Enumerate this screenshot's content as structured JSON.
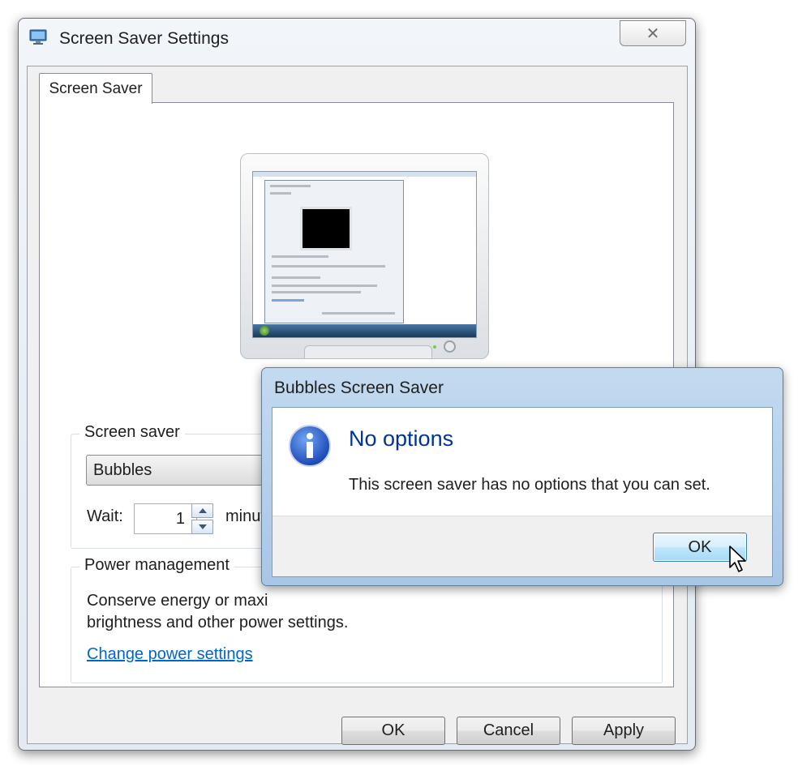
{
  "main_window": {
    "title": "Screen Saver Settings",
    "close_glyph": "✕",
    "tab_label": "Screen Saver",
    "screen_saver_group": {
      "legend": "Screen saver",
      "selected_saver": "Bubbles",
      "wait_label": "Wait:",
      "wait_value": "1",
      "wait_unit": "minut"
    },
    "power_group": {
      "legend": "Power management",
      "description": "Conserve energy or maxi",
      "description_line2": "brightness and other power settings.",
      "link_label": "Change power settings"
    },
    "buttons": {
      "ok": "OK",
      "cancel": "Cancel",
      "apply": "Apply"
    }
  },
  "message_box": {
    "title": "Bubbles Screen Saver",
    "heading": "No options",
    "body": "This screen saver has no options that you can set.",
    "ok_label": "OK",
    "icon": "info-icon"
  },
  "colors": {
    "link": "#0066cc",
    "heading": "#003399",
    "info_icon": "#1f55c6"
  }
}
